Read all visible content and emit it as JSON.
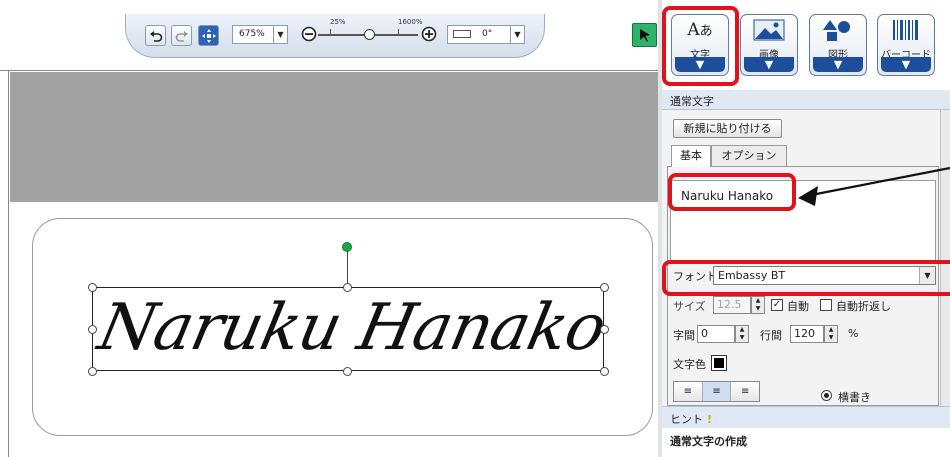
{
  "toolbar": {
    "undo_icon": "undo-icon",
    "redo_icon": "redo-icon",
    "fit_icon": "fit-to-window-icon",
    "zoom_value": "675%",
    "zoom_min_label": "25%",
    "zoom_max_label": "1600%",
    "zoom_out_icon": "zoom-out-icon",
    "zoom_in_icon": "zoom-in-icon",
    "rotation_value": "0°",
    "select_tool_icon": "cursor-arrow-icon"
  },
  "canvas": {
    "text_object": "Naruku Hanako",
    "accent": "#1ea843"
  },
  "insert_buttons": [
    {
      "label": "文字",
      "icon": "text-icon"
    },
    {
      "label": "画像",
      "icon": "image-icon"
    },
    {
      "label": "図形",
      "icon": "shape-icon"
    },
    {
      "label": "バーコード",
      "icon": "barcode-icon"
    }
  ],
  "panel": {
    "section_title": "通常文字",
    "paste_new_button": "新規に貼り付ける",
    "tabs": [
      "基本",
      "オプション"
    ],
    "text_value": "Naruku Hanako",
    "font_label": "フォント",
    "font_value": "Embassy BT",
    "size_label": "サイズ",
    "size_value": "12.5",
    "auto_label": "自動",
    "auto_wrap_label": "自動折返し",
    "char_spacing_label": "字間",
    "char_spacing_value": "0",
    "line_spacing_label": "行間",
    "line_spacing_value": "120",
    "percent": "%",
    "color_label": "文字色",
    "align_left": "≡",
    "align_center": "≡",
    "align_right": "≡",
    "orientation_label": "横書き",
    "hint_label": "ヒント",
    "hint_mark": "!",
    "hint_text": "通常文字の作成"
  },
  "colors": {
    "highlight": "#e0121b",
    "button_blue": "#1d4e9c",
    "select_green": "#2fb36b"
  }
}
